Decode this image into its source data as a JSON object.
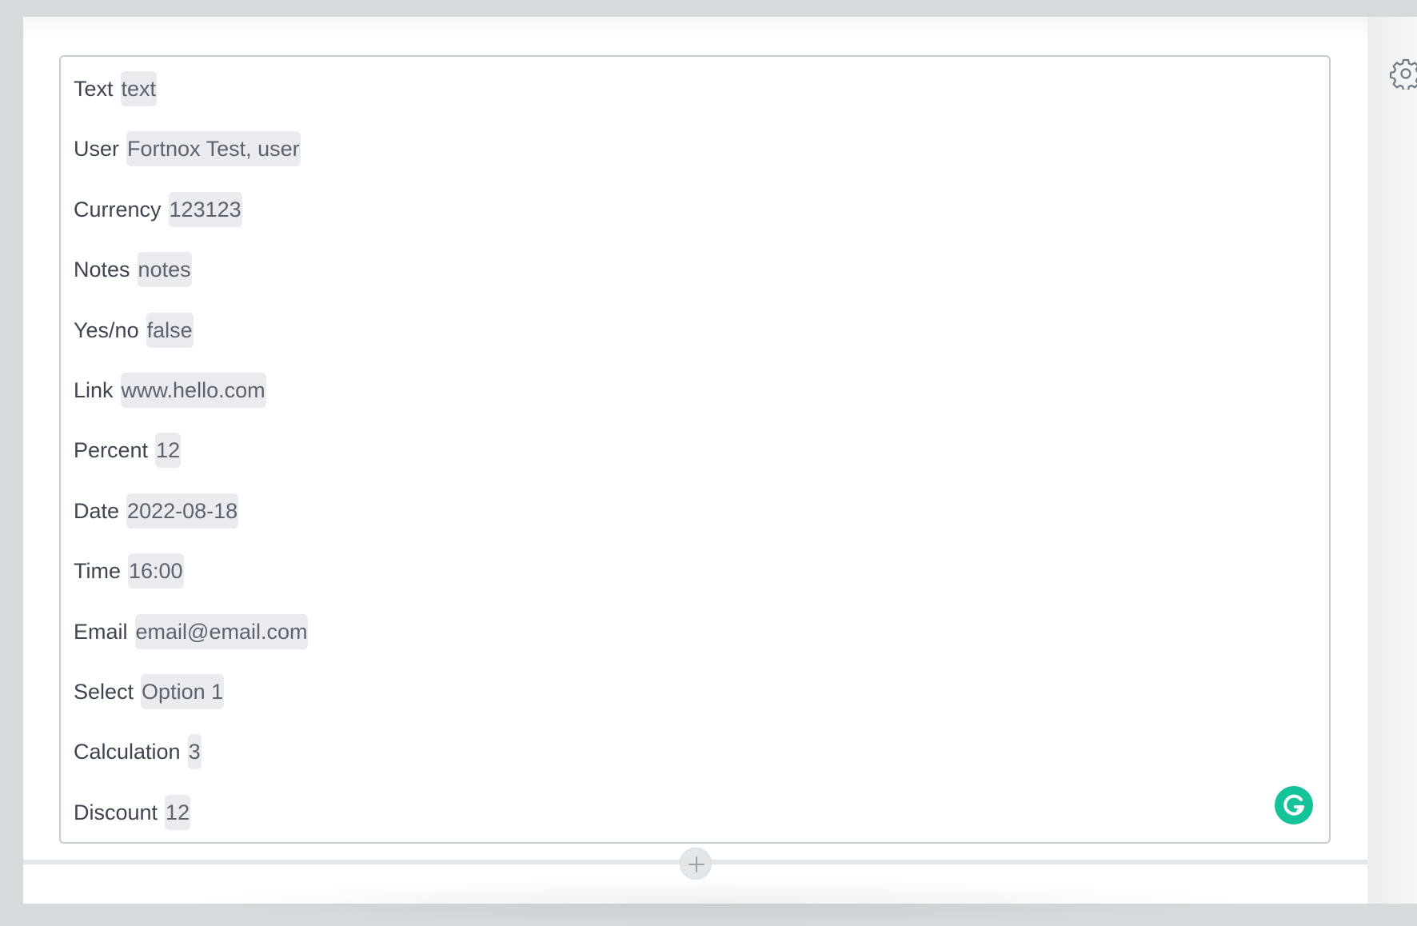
{
  "fields": [
    {
      "label": "Text",
      "value": "text"
    },
    {
      "label": "User",
      "value": "Fortnox Test, user"
    },
    {
      "label": "Currency",
      "value": "123123"
    },
    {
      "label": "Notes",
      "value": "notes"
    },
    {
      "label": "Yes/no",
      "value": "false"
    },
    {
      "label": "Link",
      "value": "www.hello.com"
    },
    {
      "label": "Percent",
      "value": "12"
    },
    {
      "label": "Date",
      "value": "2022-08-18"
    },
    {
      "label": "Time",
      "value": "16:00"
    },
    {
      "label": "Email",
      "value": "email@email.com"
    },
    {
      "label": "Select",
      "value": "Option 1"
    },
    {
      "label": "Calculation",
      "value": "3"
    },
    {
      "label": "Discount",
      "value": "12"
    }
  ],
  "icons": {
    "settings": "gear-icon",
    "grammarly": "grammarly-icon",
    "add": "plus-icon"
  },
  "colors": {
    "grammarly": "#15c39a",
    "label_text": "#3d4550",
    "value_chip_bg": "#e9ebee",
    "editor_border": "#c6ccd0"
  }
}
